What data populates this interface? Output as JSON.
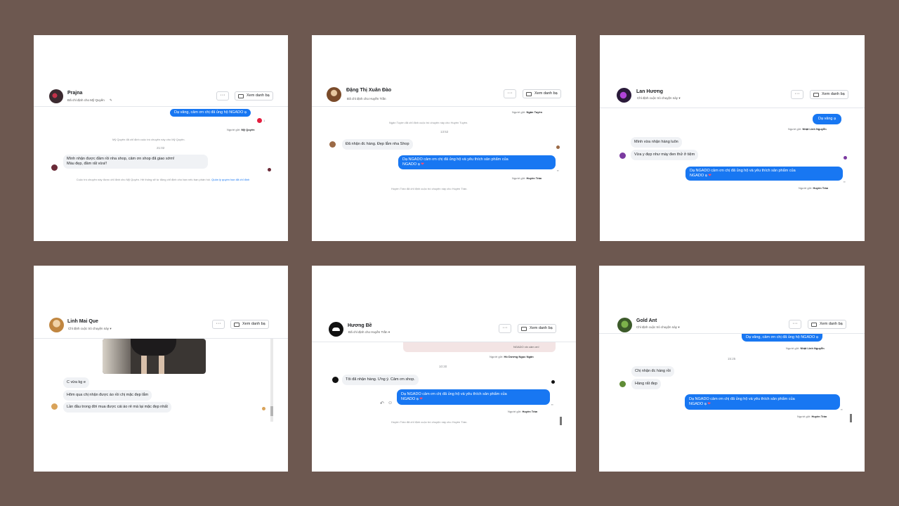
{
  "common": {
    "more_label": "···",
    "contacts_label": "Xem danh bạ",
    "sent_by": "Người gửi:"
  },
  "colors": {
    "background": "#6d5850",
    "outgoing_bubble": "#1877f2",
    "incoming_bubble": "#f0f2f5"
  },
  "card1": {
    "name": "Prajna",
    "subtitle": "Đã chỉ định cho Mỹ Quyên",
    "msg_out": "Dạ vâng, cảm ơn chị đã ủng hộ NGADO ạ",
    "reaction_count": "1",
    "sender_name": "Mỹ Quyên",
    "sys_assign": "Mỹ Quyên đã chỉ định cuộc trò chuyện này cho Mỹ Quyên.",
    "time": "21:02",
    "msg_in_1": "Mình nhận được đầm rồi nha shop, cảm ơn shop đã giao sớm!",
    "msg_in_2": "Màu đẹp, đầm rất vừa!!",
    "footer_text": "Cuộc trò chuyện này được chỉ định cho Mỹ Quyên. Hệ thống sẽ tự động chỉ định cho bạn nếu bạn phản hồi.",
    "footer_link": "Quản lý quyền hạn đã chỉ định"
  },
  "card2": {
    "name": "Đặng Thị Xuân Đào",
    "subtitle": "Đã chỉ định cho Huyền Trần",
    "sender_top": "Ngân Tuyền",
    "sys_assign_1": "Ngân Tuyền đã chỉ định cuộc trò chuyện này cho Huyền Tuyền.",
    "time": "13:52",
    "msg_in": "Đã nhận đc hàng. Đẹp lắm nha  Shop",
    "msg_out_1": "Dạ NGADO cảm ơn chị đã ủng hộ và yêu thích sản phẩm của",
    "msg_out_2": "NGADO ạ",
    "sender_bottom": "Huyền Trần",
    "sys_assign_2": "Huyền Trần đã chỉ định cuộc trò chuyện này cho Huyền Trần."
  },
  "card3": {
    "name": "Lan Hương",
    "subtitle": "Chỉ định cuộc trò chuyện này",
    "msg_out_short": "Dạ vâng ạ",
    "sender_top": "Nhật Linh Nguyễn",
    "msg_in_1": "Mình vừa nhận hàng luôn",
    "msg_in_2": "Vừa y đẹp như mày đen thử ở tiệm",
    "msg_out_1": "Dạ NGADO cảm ơn chị đã ủng hộ và yêu thích sản phẩm của",
    "msg_out_2": "NGADO ạ",
    "sender_bottom": "Huyền Trần"
  },
  "card4": {
    "name": "Linh Mai Que",
    "subtitle": "Chỉ định cuộc trò chuyện này",
    "msg_in_1": "C vừa kg e",
    "msg_in_2": "Hôm qua chị nhận được áo rồi chị mặc đẹp lắm",
    "msg_in_3": "Lần đầu trong đời mua được cái áo rẻ mà lại mặc đẹp nhất"
  },
  "card5": {
    "name": "Hương Bề",
    "subtitle": "Đã chỉ định cho Huyền Trần",
    "quoted_text": "NGADO xin cảm ơn!",
    "sender_top": "Hồ Dương Ngọc Ngân",
    "time": "10:30",
    "msg_in": "Tôi đã nhận hàng. Ưng ý. Cảm ơn shop.",
    "msg_out_1": "Dạ NGADO cảm ơn chị đã ủng hộ và yêu thích sản phẩm của",
    "msg_out_2": "NGADO ạ",
    "sender_bottom": "Huyền Trần",
    "sys_assign": "Huyền Trần đã chỉ định cuộc trò chuyện này cho Huyền Trần."
  },
  "card6": {
    "name": "Gold Ant",
    "subtitle": "Chỉ định cuộc trò chuyện này",
    "msg_out_top": "Dạ vâng, cảm ơn chị đã ủng hộ NGADO ạ",
    "sender_top": "Nhật Linh Nguyễn",
    "time": "15:25",
    "msg_in_1": "Chị nhận đc hàng rồi",
    "msg_in_2": "Hàng rất đẹp",
    "msg_out_1": "Dạ NGADO cảm ơn chị đã ủng hộ và yêu thích sản phẩm của",
    "msg_out_2": "NGADO ạ",
    "sender_bottom": "Huyền Trần"
  }
}
